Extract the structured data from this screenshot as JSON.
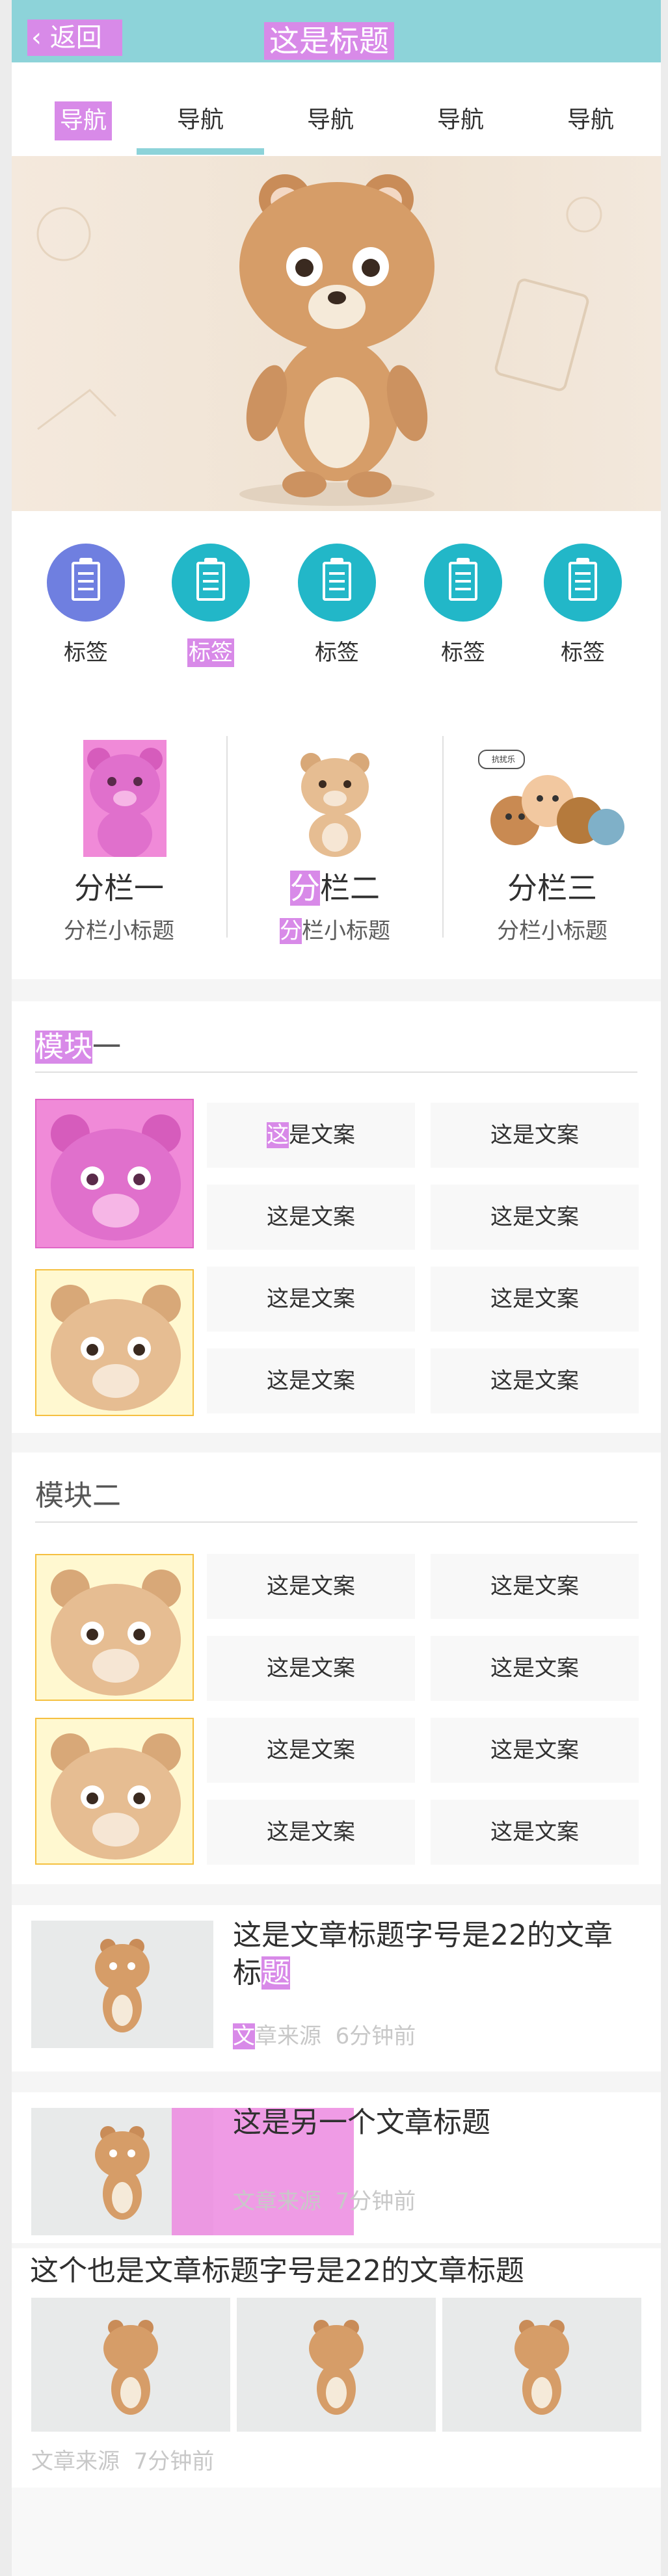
{
  "header": {
    "back_label": "返回",
    "title": "这是标题"
  },
  "nav": {
    "items": [
      "导航",
      "导航",
      "导航",
      "导航",
      "导航"
    ]
  },
  "categories": [
    "标签",
    "标签",
    "标签",
    "标签",
    "标签"
  ],
  "columns": [
    {
      "title": "分栏一",
      "subtitle": "分栏小标题"
    },
    {
      "title": "分栏二",
      "subtitle": "分栏小标题"
    },
    {
      "title": "分栏三",
      "subtitle": "分栏小标题"
    }
  ],
  "column3_badge": "抗扰乐",
  "module1": {
    "title": "模块一",
    "texts": [
      "这是文案",
      "这是文案",
      "这是文案",
      "这是文案",
      "这是文案",
      "这是文案",
      "这是文案",
      "这是文案"
    ]
  },
  "module2": {
    "title": "模块二",
    "texts": [
      "这是文案",
      "这是文案",
      "这是文案",
      "这是文案",
      "这是文案",
      "这是文案",
      "这是文案",
      "这是文案"
    ]
  },
  "articles": [
    {
      "title": "这是文章标题字号是22的文章标题",
      "source": "文章来源",
      "time": "6分钟前"
    },
    {
      "title": "这是另一个文章标题",
      "source": "文章来源",
      "time": "7分钟前"
    },
    {
      "title": "这个也是文章标题字号是22的文章标题",
      "source": "文章来源",
      "time": "7分钟前"
    }
  ],
  "colors": {
    "header": "#8dd3d9",
    "accent": "#22b7c8",
    "text": "#303030",
    "muted": "#c8c8c8"
  }
}
